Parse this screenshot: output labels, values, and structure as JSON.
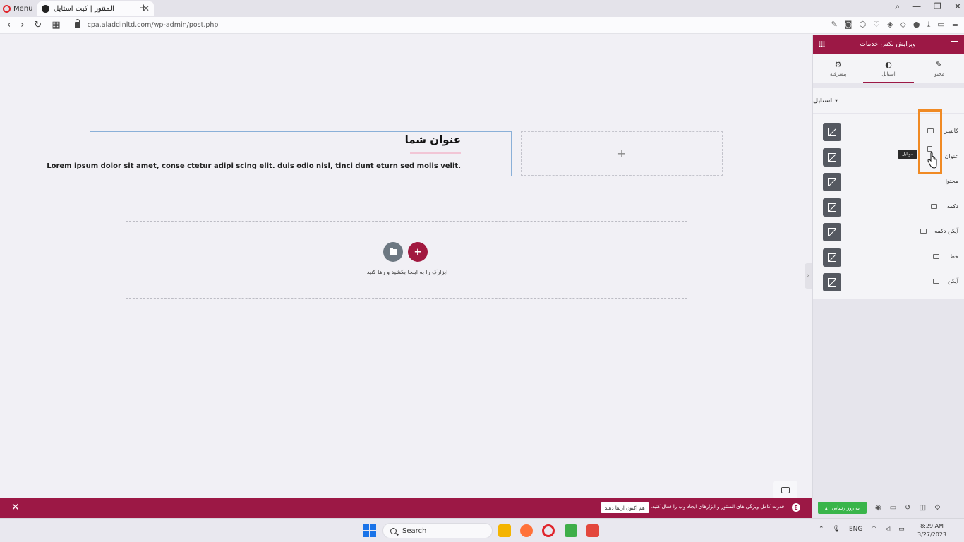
{
  "browser": {
    "menu_label": "Menu",
    "tab_title": "المنتور | کیت استایل",
    "url_host": "cpa.aladdinltd.com",
    "url_path": "/wp-admin/post.php"
  },
  "canvas": {
    "heading": "عنوان شما",
    "body_text": "Lorem ipsum dolor sit amet, conse ctetur adipi scing elit. duis odio nisl, tinci dunt eturn sed molis velit.",
    "drop_hint": "ابزارک را به اینجا بکشید و رها کنید"
  },
  "panel": {
    "title": "ویرایش بکس خدمات",
    "tabs": [
      {
        "label": "محتوا",
        "icon": "pencil-icon"
      },
      {
        "label": "استایل",
        "icon": "contrast-icon"
      },
      {
        "label": "پیشرفته",
        "icon": "gear-icon"
      }
    ],
    "section_title": "استایل",
    "rows": [
      {
        "label": "کانتینر"
      },
      {
        "label": "عنوان"
      },
      {
        "label": "محتوا"
      },
      {
        "label": "دکمه"
      },
      {
        "label": "آیکن دکمه"
      },
      {
        "label": "خط"
      },
      {
        "label": "آیکن"
      }
    ],
    "tooltip": "موبایل"
  },
  "banner": {
    "text": "قدرت کامل ویژگی های المنتور و ابزارهای ایجاد وب را فعال کنید.",
    "button": "هم اکنون ارتقا دهید",
    "publish": "به روز رسانی"
  },
  "taskbar": {
    "search_placeholder": "Search",
    "lang": "ENG",
    "time": "8:29 AM",
    "date": "3/27/2023"
  },
  "colors": {
    "accent": "#9c1845",
    "highlight": "#f08a24",
    "publish": "#39b54a"
  }
}
